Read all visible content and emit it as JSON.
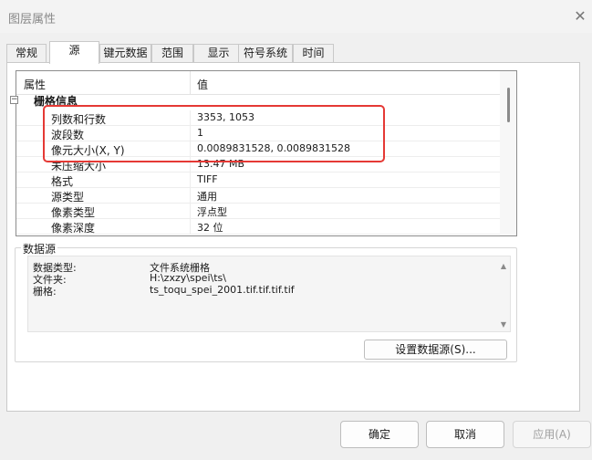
{
  "window": {
    "title": "图层属性",
    "close_symbol": "✕"
  },
  "tabs": [
    {
      "label": "常规",
      "active": false
    },
    {
      "label": "源",
      "active": true
    },
    {
      "label": "键元数据",
      "active": false
    },
    {
      "label": "范围",
      "active": false
    },
    {
      "label": "显示",
      "active": false
    },
    {
      "label": "符号系统",
      "active": false
    },
    {
      "label": "时间",
      "active": false
    }
  ],
  "property_table": {
    "header_property": "属性",
    "header_value": "值",
    "group": {
      "label": "栅格信息",
      "toggle": "−"
    },
    "rows": [
      {
        "key": "列数和行数",
        "value": "3353, 1053"
      },
      {
        "key": "波段数",
        "value": "1"
      },
      {
        "key": "像元大小(X, Y)",
        "value": "0.0089831528, 0.0089831528"
      },
      {
        "key": "未压缩大小",
        "value": "13.47 MB"
      },
      {
        "key": "格式",
        "value": "TIFF"
      },
      {
        "key": "源类型",
        "value": "通用"
      },
      {
        "key": "像素类型",
        "value": "浮点型"
      },
      {
        "key": "像素深度",
        "value": "32 位"
      }
    ],
    "highlight_color": "#e53935"
  },
  "data_source": {
    "label": "数据源",
    "rows": [
      {
        "key": "数据类型:",
        "value": "文件系统栅格"
      },
      {
        "key": "文件夹:",
        "value": "H:\\zxzy\\spei\\ts\\"
      },
      {
        "key": "栅格:",
        "value": "ts_toqu_spei_2001.tif.tif.tif.tif"
      }
    ],
    "scroll_up": "▲",
    "scroll_down": "▼",
    "set_source_button": "设置数据源(S)..."
  },
  "footer": {
    "ok_label": "确定",
    "cancel_label": "取消",
    "apply_label": "应用(A)"
  }
}
